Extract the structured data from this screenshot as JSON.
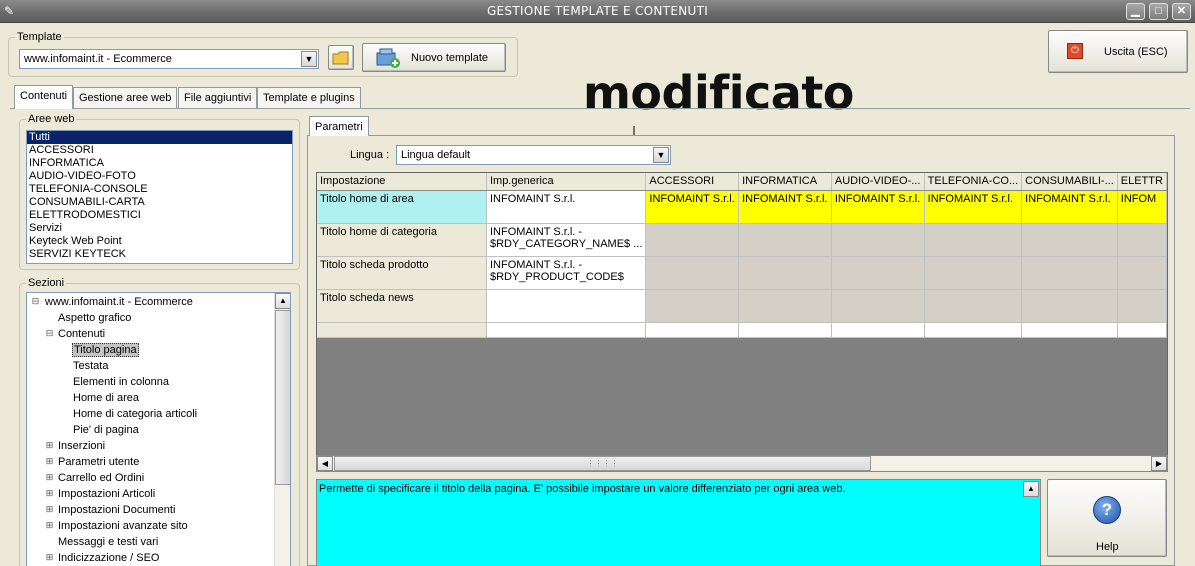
{
  "window": {
    "title": "GESTIONE TEMPLATE E CONTENUTI",
    "controls": {
      "minimize": "▁",
      "maximize": "□",
      "close": "✕"
    }
  },
  "template_group": {
    "legend": "Template",
    "selected": "www.infomaint.it - Ecommerce",
    "new_template_label": "Nuovo template"
  },
  "exit_button": {
    "label": "Uscita (ESC)"
  },
  "annotation": {
    "text": "modificato"
  },
  "tabs": [
    {
      "label": "Contenuti"
    },
    {
      "label": "Gestione aree web"
    },
    {
      "label": "File aggiuntivi"
    },
    {
      "label": "Template e plugins"
    }
  ],
  "aree_web": {
    "legend": "Aree web",
    "items": [
      "Tutti",
      "ACCESSORI",
      "INFORMATICA",
      "AUDIO-VIDEO-FOTO",
      "TELEFONIA-CONSOLE",
      "CONSUMABILI-CARTA",
      "ELETTRODOMESTICI",
      "Servizi",
      "Keyteck Web Point",
      "SERVIZI KEYTECK"
    ],
    "selected_index": 0
  },
  "sezioni": {
    "legend": "Sezioni",
    "nodes": [
      {
        "label": "www.infomaint.it - Ecommerce",
        "level": 0,
        "toggle": "⊟"
      },
      {
        "label": "Aspetto grafico",
        "level": 1,
        "toggle": ""
      },
      {
        "label": "Contenuti",
        "level": 1,
        "toggle": "⊟"
      },
      {
        "label": "Titolo pagina",
        "level": 2,
        "toggle": "",
        "selected": true
      },
      {
        "label": "Testata",
        "level": 2,
        "toggle": ""
      },
      {
        "label": "Elementi in colonna",
        "level": 2,
        "toggle": ""
      },
      {
        "label": "Home di area",
        "level": 2,
        "toggle": ""
      },
      {
        "label": "Home di categoria articoli",
        "level": 2,
        "toggle": ""
      },
      {
        "label": "Pie' di pagina",
        "level": 2,
        "toggle": ""
      },
      {
        "label": "Inserzioni",
        "level": 1,
        "toggle": "⊞"
      },
      {
        "label": "Parametri utente",
        "level": 1,
        "toggle": "⊞"
      },
      {
        "label": "Carrello ed Ordini",
        "level": 1,
        "toggle": "⊞"
      },
      {
        "label": "Impostazioni Articoli",
        "level": 1,
        "toggle": "⊞"
      },
      {
        "label": "Impostazioni Documenti",
        "level": 1,
        "toggle": "⊞"
      },
      {
        "label": "Impostazioni avanzate sito",
        "level": 1,
        "toggle": "⊞"
      },
      {
        "label": "Messaggi e testi vari",
        "level": 1,
        "toggle": ""
      },
      {
        "label": "Indicizzazione / SEO",
        "level": 1,
        "toggle": "⊞"
      }
    ]
  },
  "parametri": {
    "tab_label": "Parametri",
    "lingua_label": "Lingua :",
    "lingua_value": "Lingua default",
    "columns": [
      "Impostazione",
      "Imp.generica",
      "ACCESSORI",
      "INFORMATICA",
      "AUDIO-VIDEO-...",
      "TELEFONIA-CO...",
      "CONSUMABILI-...",
      "ELETTR"
    ],
    "rows": [
      {
        "key": "Titolo home di area",
        "generic": [
          "INFOMAINT S.r.l."
        ],
        "area_value": "INFOMAINT S.r.l.",
        "selected": true
      },
      {
        "key": "Titolo home di categoria",
        "generic": [
          "INFOMAINT S.r.l. -",
          "$RDY_CATEGORY_NAME$ ..."
        ],
        "area_value": ""
      },
      {
        "key": "Titolo scheda prodotto",
        "generic": [
          "INFOMAINT S.r.l. -",
          "$RDY_PRODUCT_CODE$"
        ],
        "area_value": ""
      },
      {
        "key": "Titolo scheda news",
        "generic": [
          ""
        ],
        "area_value": ""
      },
      {
        "key": "",
        "generic": [
          ""
        ],
        "area_value": ""
      }
    ],
    "last_col_value": "INFOM"
  },
  "description": {
    "text": "Permette di specificare il titolo della pagina. E' possibile impostare un valore differenziato per ogni area web."
  },
  "help_button": {
    "label": "Help"
  }
}
